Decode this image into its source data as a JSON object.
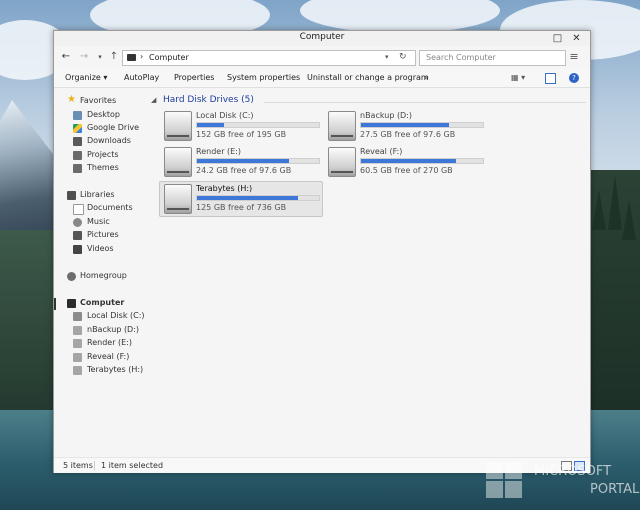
{
  "window": {
    "title": "Computer"
  },
  "address": {
    "path": "Computer",
    "search_placeholder": "Search Computer"
  },
  "toolbar": {
    "organize": "Organize",
    "autoplay": "AutoPlay",
    "properties": "Properties",
    "system_properties": "System properties",
    "uninstall": "Uninstall or change a program",
    "more": "»"
  },
  "nav": {
    "favorites": "Favorites",
    "desktop": "Desktop",
    "google_drive": "Google Drive",
    "downloads": "Downloads",
    "projects": "Projects",
    "themes": "Themes",
    "libraries": "Libraries",
    "documents": "Documents",
    "music": "Music",
    "pictures": "Pictures",
    "videos": "Videos",
    "homegroup": "Homegroup",
    "computer": "Computer",
    "local_disk": "Local Disk (C:)",
    "nbackup": "nBackup (D:)",
    "render": "Render (E:)",
    "reveal": "Reveal (F:)",
    "terabytes": "Terabytes (H:)"
  },
  "group": {
    "title": "Hard Disk Drives (5)"
  },
  "drives": [
    {
      "name": "Local Disk (C:)",
      "free": "152 GB free of 195 GB",
      "used_fraction": 0.22
    },
    {
      "name": "nBackup (D:)",
      "free": "27.5 GB free of 97.6 GB",
      "used_fraction": 0.72
    },
    {
      "name": "Render (E:)",
      "free": "24.2 GB free of 97.6 GB",
      "used_fraction": 0.75
    },
    {
      "name": "Reveal (F:)",
      "free": "60.5 GB free of 270 GB",
      "used_fraction": 0.78
    },
    {
      "name": "Terabytes (H:)",
      "free": "125 GB free of 736 GB",
      "used_fraction": 0.83
    }
  ],
  "status": {
    "items": "5 items",
    "selected": "1 item selected"
  },
  "watermark": {
    "line1": "MICROSOFT",
    "line2": "PORTAL"
  },
  "colors": {
    "bar_fill": "#3d78d8",
    "group_header": "#1f3fa0"
  }
}
